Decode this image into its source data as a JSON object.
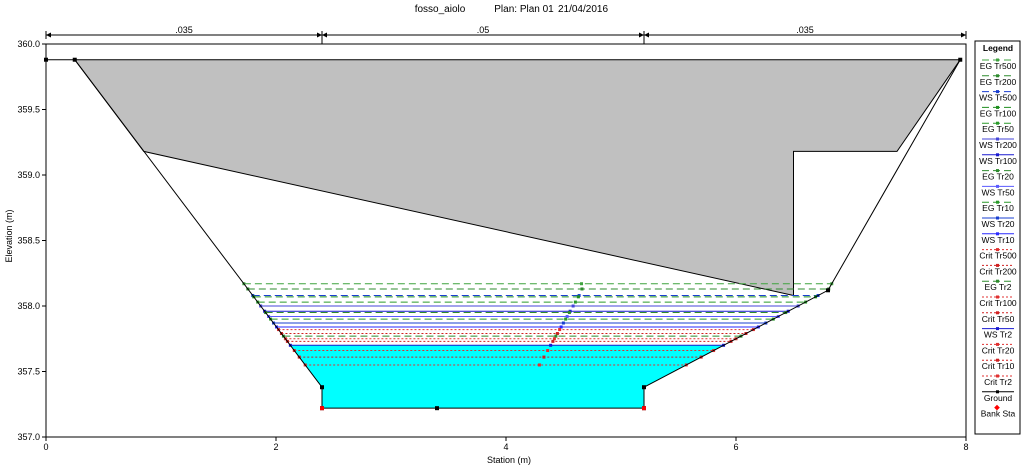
{
  "chart_data": {
    "type": "line",
    "title": "fosso_aiolo",
    "plan_label": "Plan: Plan 01",
    "date_label": "21/04/2016",
    "xlabel": "Station (m)",
    "ylabel": "Elevation (m)",
    "xlim": [
      0,
      8
    ],
    "ylim": [
      357.0,
      360.0
    ],
    "x_ticks": [
      0,
      2,
      4,
      6,
      8
    ],
    "y_ticks": [
      357.0,
      357.5,
      358.0,
      358.5,
      359.0,
      359.5,
      360.0
    ],
    "y_tick_labels": [
      "357.0",
      "357.5",
      "358.0",
      "358.5",
      "359.0",
      "359.5",
      "360.0"
    ],
    "x_tick_labels": [
      "0",
      "2",
      "4",
      "6",
      "8"
    ],
    "mannings_n": [
      {
        "x_from": 0,
        "x_to": 2.4,
        "label": ".035"
      },
      {
        "x_from": 2.4,
        "x_to": 5.2,
        "label": ".05"
      },
      {
        "x_from": 5.2,
        "x_to": 8.0,
        "label": ".035"
      }
    ],
    "bank_stations": [
      2.4,
      5.2
    ],
    "ground": {
      "x": [
        0.0,
        0.25,
        2.4,
        2.4,
        3.4,
        5.2,
        5.2,
        6.8,
        7.95
      ],
      "y": [
        359.88,
        359.88,
        357.38,
        357.22,
        357.22,
        357.22,
        357.38,
        358.12,
        359.88
      ]
    },
    "bridge_deck": {
      "x": [
        0.25,
        7.95,
        7.4,
        6.5,
        6.5,
        0.85
      ],
      "y": [
        359.88,
        359.88,
        359.18,
        359.18,
        358.08,
        359.18
      ]
    },
    "water_fill_elevation": 357.7,
    "series": [
      {
        "name": "EG Tr500",
        "y": 358.17,
        "color": "#3fa33f",
        "style": "dash",
        "marker": "x"
      },
      {
        "name": "EG Tr200",
        "y": 358.13,
        "color": "#2e8b2e",
        "style": "dash",
        "marker": "plus"
      },
      {
        "name": "WS Tr500",
        "y": 358.08,
        "color": "#1a3fd1",
        "style": "dash",
        "marker": "square"
      },
      {
        "name": "EG Tr100",
        "y": 358.07,
        "color": "#1f8f1f",
        "style": "dash",
        "marker": "square"
      },
      {
        "name": "EG Tr50",
        "y": 358.03,
        "color": "#2a9a2a",
        "style": "dash",
        "marker": "x"
      },
      {
        "name": "WS Tr200",
        "y": 358.0,
        "color": "#4646d8",
        "style": "solid",
        "marker": "circle"
      },
      {
        "name": "WS Tr100",
        "y": 357.96,
        "color": "#1a1ad1",
        "style": "solid",
        "marker": "square"
      },
      {
        "name": "EG Tr20",
        "y": 357.95,
        "color": "#2e8b2e",
        "style": "dash",
        "marker": "plus"
      },
      {
        "name": "WS Tr50",
        "y": 357.92,
        "color": "#5a5aff",
        "style": "solid",
        "marker": "x"
      },
      {
        "name": "EG Tr10",
        "y": 357.9,
        "color": "#2a9a2a",
        "style": "dash",
        "marker": "triangle"
      },
      {
        "name": "WS Tr20",
        "y": 357.87,
        "color": "#1a3fd1",
        "style": "solid",
        "marker": "triangle"
      },
      {
        "name": "WS Tr10",
        "y": 357.84,
        "color": "#2a2aff",
        "style": "solid",
        "marker": "triangle"
      },
      {
        "name": "Crit Tr500",
        "y": 357.82,
        "color": "#e03030",
        "style": "dot",
        "marker": "circle"
      },
      {
        "name": "Crit Tr200",
        "y": 357.79,
        "color": "#d02020",
        "style": "dot",
        "marker": "x"
      },
      {
        "name": "EG Tr2",
        "y": 357.77,
        "color": "#2e8b2e",
        "style": "dash",
        "marker": "none"
      },
      {
        "name": "Crit Tr100",
        "y": 357.75,
        "color": "#e03030",
        "style": "dot",
        "marker": "x"
      },
      {
        "name": "Crit Tr50",
        "y": 357.73,
        "color": "#d02020",
        "style": "dot",
        "marker": "none"
      },
      {
        "name": "WS Tr2",
        "y": 357.7,
        "color": "#1a1ad1",
        "style": "solid",
        "marker": "none"
      },
      {
        "name": "Crit Tr20",
        "y": 357.66,
        "color": "#e03030",
        "style": "dot",
        "marker": "circle"
      },
      {
        "name": "Crit Tr10",
        "y": 357.61,
        "color": "#d02020",
        "style": "dot",
        "marker": "x"
      },
      {
        "name": "Crit Tr2",
        "y": 357.55,
        "color": "#e03030",
        "style": "dot",
        "marker": "none"
      }
    ],
    "legend": {
      "title": "Legend",
      "placement": "right",
      "entries": [
        "EG Tr500",
        "EG Tr200",
        "WS Tr500",
        "EG Tr100",
        "EG Tr50",
        "WS Tr200",
        "WS Tr100",
        "EG Tr20",
        "WS Tr50",
        "EG Tr10",
        "WS Tr20",
        "WS Tr10",
        "Crit Tr500",
        "Crit Tr200",
        "EG Tr2",
        "Crit Tr100",
        "Crit Tr50",
        "WS Tr2",
        "Crit Tr20",
        "Crit Tr10",
        "Crit Tr2",
        "Ground",
        "Bank Sta"
      ]
    },
    "colors": {
      "water": "#00ffff",
      "bridge_fill": "#c0c0c0",
      "ground": "#000000",
      "bank_sta": "#ff0000"
    },
    "grid": false
  }
}
